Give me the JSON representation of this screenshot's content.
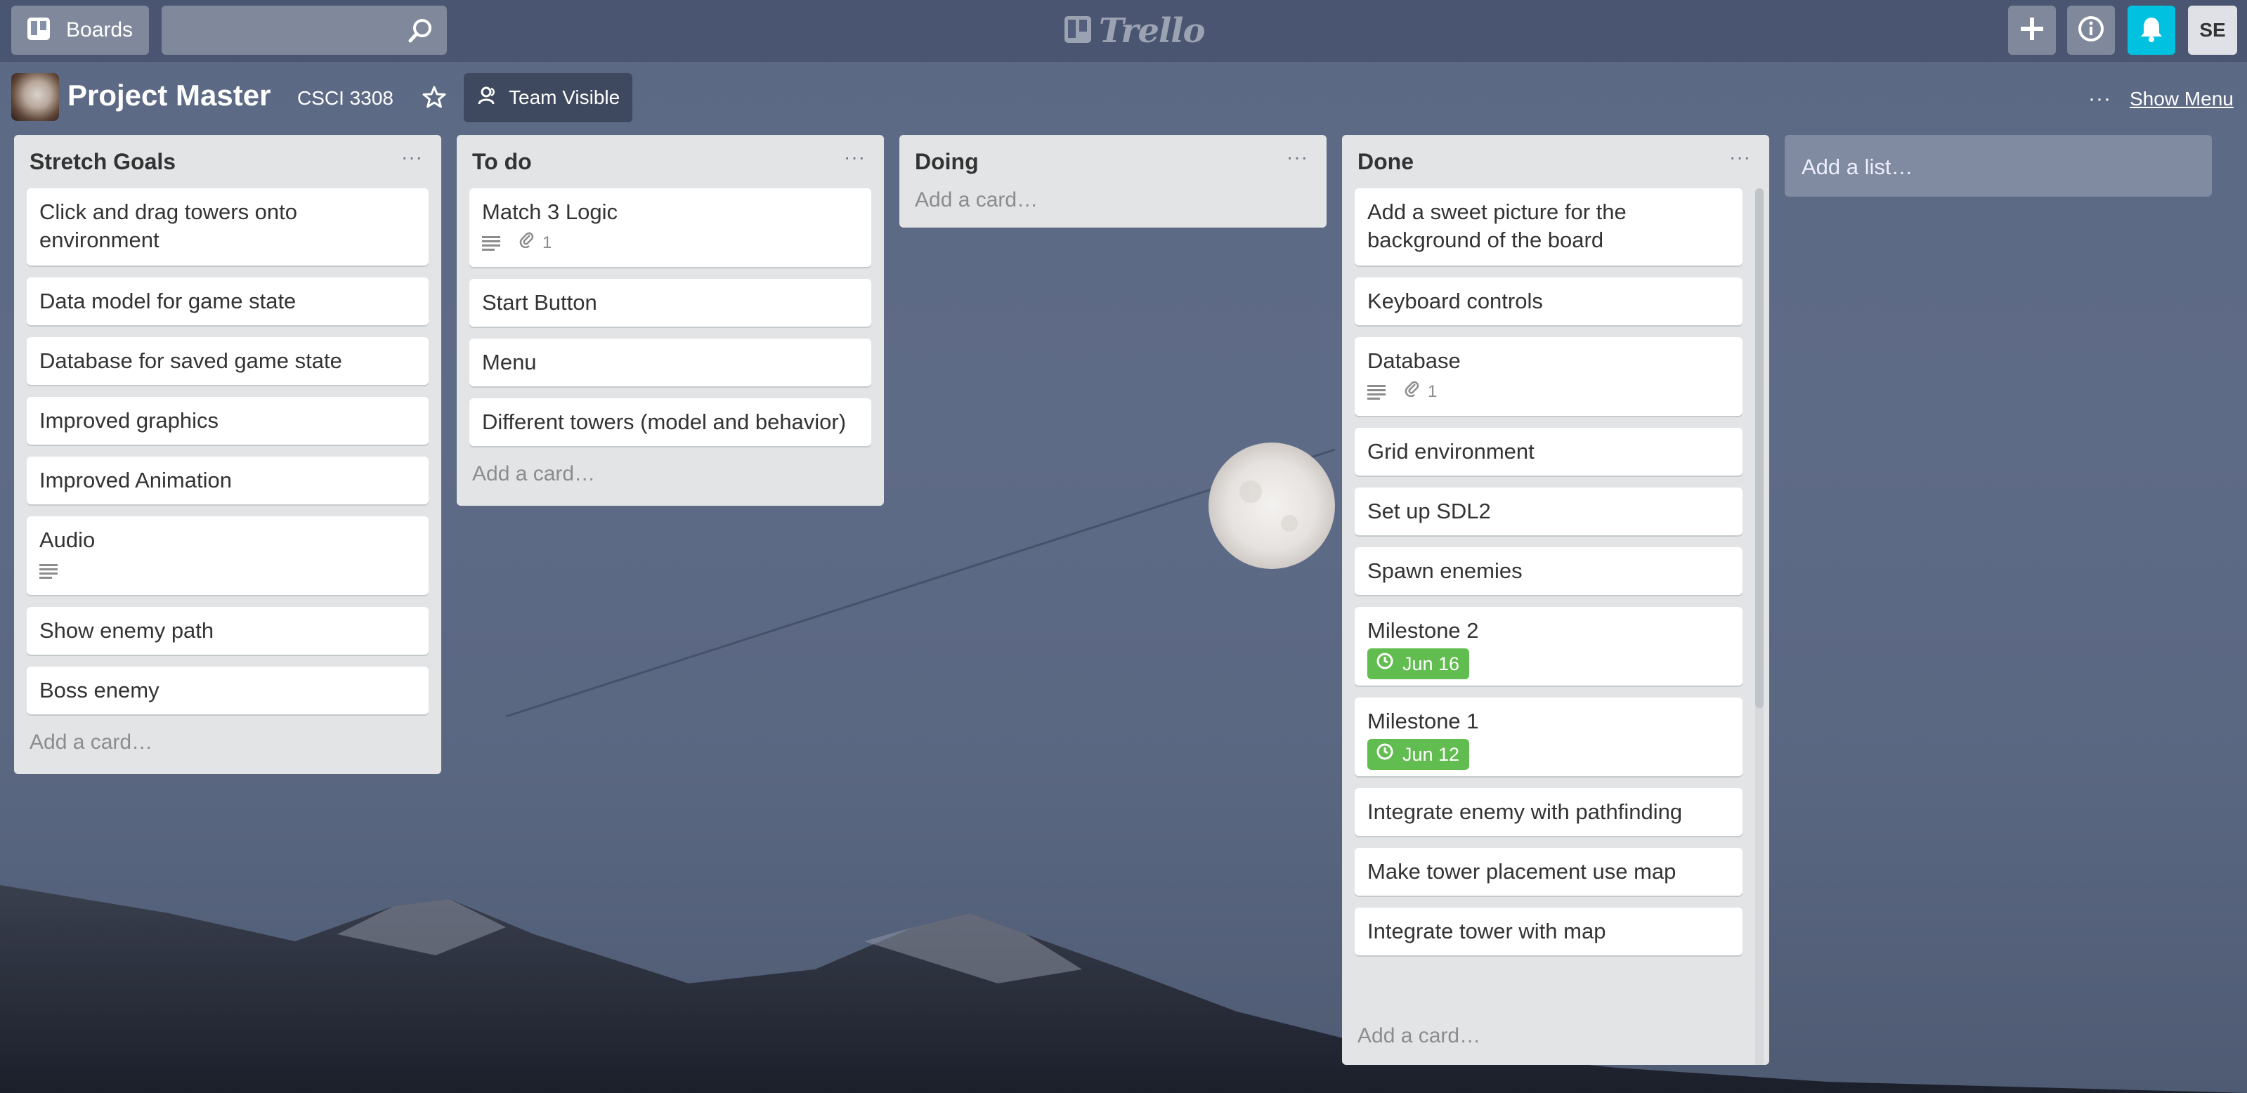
{
  "header": {
    "boards_label": "Boards",
    "logo_text": "Trello",
    "search": {
      "placeholder": ""
    },
    "avatar_initials": "SE",
    "bell_color": "#00c2e0"
  },
  "board": {
    "title": "Project Master",
    "team": "CSCI 3308",
    "visibility": "Team Visible",
    "menu_dots": "···",
    "show_menu": "Show Menu",
    "add_list": "Add a list…"
  },
  "lists": [
    {
      "title": "Stretch Goals",
      "menu": "···",
      "add_card": "Add a card…",
      "cards": [
        {
          "title": "Click and drag towers onto environment"
        },
        {
          "title": "Data model for game state"
        },
        {
          "title": "Database for saved game state"
        },
        {
          "title": "Improved graphics"
        },
        {
          "title": "Improved Animation"
        },
        {
          "title": "Audio",
          "description": true
        },
        {
          "title": "Show enemy path"
        },
        {
          "title": "Boss enemy"
        }
      ]
    },
    {
      "title": "To do",
      "menu": "···",
      "add_card": "Add a card…",
      "cards": [
        {
          "title": "Match 3 Logic",
          "description": true,
          "attachments": "1"
        },
        {
          "title": "Start Button"
        },
        {
          "title": "Menu"
        },
        {
          "title": "Different towers (model and behavior)"
        }
      ]
    },
    {
      "title": "Doing",
      "menu": "···",
      "add_card": "Add a card…",
      "cards": []
    },
    {
      "title": "Done",
      "menu": "···",
      "add_card": "Add a card…",
      "cards": [
        {
          "title": "Add a sweet picture for the background of the board"
        },
        {
          "title": "Keyboard controls"
        },
        {
          "title": "Database",
          "description": true,
          "attachments": "1"
        },
        {
          "title": "Grid environment"
        },
        {
          "title": "Set up SDL2"
        },
        {
          "title": "Spawn enemies"
        },
        {
          "title": "Milestone 2",
          "due": "Jun 16"
        },
        {
          "title": "Milestone 1",
          "due": "Jun 12"
        },
        {
          "title": "Integrate enemy with pathfinding"
        },
        {
          "title": "Make tower placement use map"
        },
        {
          "title": "Integrate tower with map"
        }
      ]
    }
  ],
  "colors": {
    "due_badge": "#61bd4f",
    "list_bg": "#e2e4e6"
  }
}
